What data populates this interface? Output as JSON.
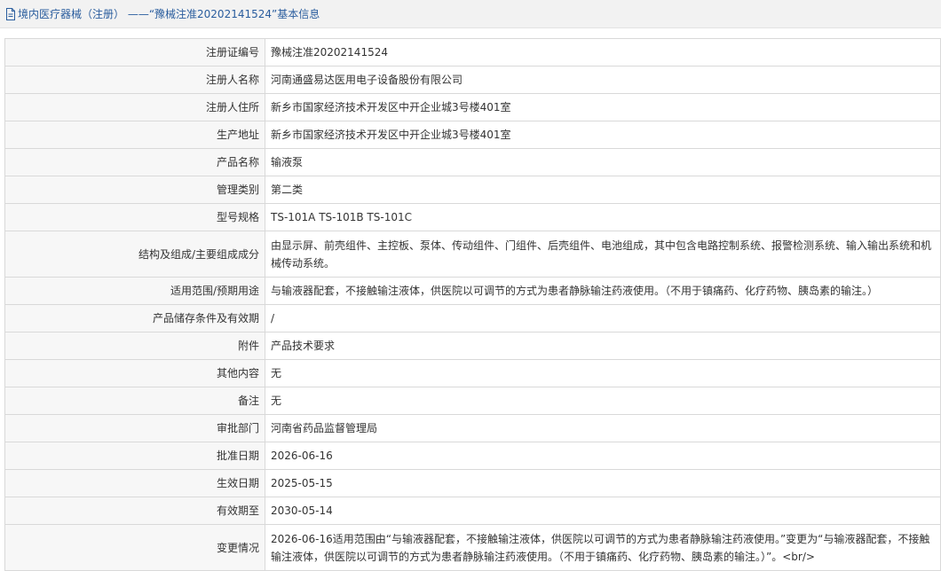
{
  "header": {
    "title": "境内医疗器械（注册） ——“豫械注准20202141524”基本信息",
    "icon": "document-icon"
  },
  "rows": [
    {
      "label": "注册证编号",
      "value": "豫械注准20202141524"
    },
    {
      "label": "注册人名称",
      "value": "河南通盛易达医用电子设备股份有限公司"
    },
    {
      "label": "注册人住所",
      "value": "新乡市国家经济技术开发区中开企业城3号楼401室"
    },
    {
      "label": "生产地址",
      "value": "新乡市国家经济技术开发区中开企业城3号楼401室"
    },
    {
      "label": "产品名称",
      "value": "输液泵"
    },
    {
      "label": "管理类别",
      "value": "第二类"
    },
    {
      "label": "型号规格",
      "value": "TS-101A TS-101B TS-101C"
    },
    {
      "label": "结构及组成/主要组成成分",
      "value": "由显示屏、前壳组件、主控板、泵体、传动组件、门组件、后壳组件、电池组成，其中包含电路控制系统、报警检测系统、输入输出系统和机械传动系统。"
    },
    {
      "label": "适用范围/预期用途",
      "value": "与输液器配套，不接触输注液体，供医院以可调节的方式为患者静脉输注药液使用。（不用于镇痛药、化疗药物、胰岛素的输注。）"
    },
    {
      "label": "产品储存条件及有效期",
      "value": "/"
    },
    {
      "label": "附件",
      "value": "产品技术要求"
    },
    {
      "label": "其他内容",
      "value": "无"
    },
    {
      "label": "备注",
      "value": "无"
    },
    {
      "label": "审批部门",
      "value": "河南省药品监督管理局"
    },
    {
      "label": "批准日期",
      "value": "2026-06-16"
    },
    {
      "label": "生效日期",
      "value": "2025-05-15"
    },
    {
      "label": "有效期至",
      "value": "2030-05-14"
    },
    {
      "label": "变更情况",
      "value": "2026-06-16适用范围由“与输液器配套，不接触输注液体，供医院以可调节的方式为患者静脉输注药液使用。”变更为“与输液器配套，不接触输注液体，供医院以可调节的方式为患者静脉输注药液使用。（不用于镇痛药、化疗药物、胰岛素的输注。）”。<br/>"
    }
  ]
}
